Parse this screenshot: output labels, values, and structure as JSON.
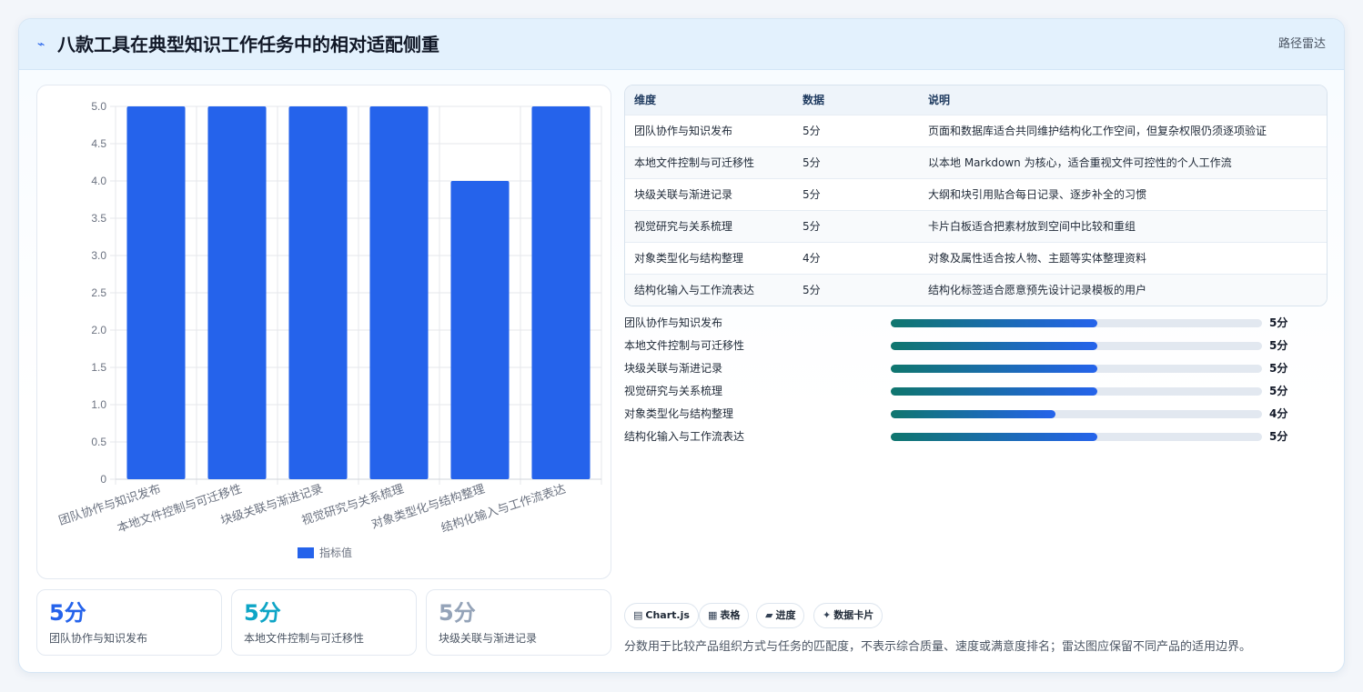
{
  "header": {
    "title": "八款工具在典型知识工作任务中的相对适配侧重",
    "tag": "路径雷达"
  },
  "chart_data": {
    "type": "bar",
    "categories": [
      "团队协作与知识发布",
      "本地文件控制与可迁移性",
      "块级关联与渐进记录",
      "视觉研究与关系梳理",
      "对象类型化与结构整理",
      "结构化输入与工作流表达"
    ],
    "series": [
      {
        "name": "指标值",
        "values": [
          5,
          5,
          5,
          5,
          4,
          5
        ],
        "color": "#2563eb"
      }
    ],
    "ylim": [
      0,
      5
    ],
    "yticks": [
      "0",
      "0.5",
      "1.0",
      "1.5",
      "2.0",
      "2.5",
      "3.0",
      "3.5",
      "4.0",
      "4.5",
      "5.0"
    ],
    "grid": true,
    "legend": "bottom"
  },
  "stats": [
    {
      "value": "5分",
      "label": "团队协作与知识发布",
      "color": "#2563eb"
    },
    {
      "value": "5分",
      "label": "本地文件控制与可迁移性",
      "color": "#0ea5c6"
    },
    {
      "value": "5分",
      "label": "块级关联与渐进记录",
      "color": "#94a3b8"
    }
  ],
  "table": {
    "headers": [
      "维度",
      "数据",
      "说明"
    ],
    "rows": [
      [
        "团队协作与知识发布",
        "5分",
        "页面和数据库适合共同维护结构化工作空间，但复杂权限仍须逐项验证"
      ],
      [
        "本地文件控制与可迁移性",
        "5分",
        "以本地 Markdown 为核心，适合重视文件可控性的个人工作流"
      ],
      [
        "块级关联与渐进记录",
        "5分",
        "大纲和块引用贴合每日记录、逐步补全的习惯"
      ],
      [
        "视觉研究与关系梳理",
        "5分",
        "卡片白板适合把素材放到空间中比较和重组"
      ],
      [
        "对象类型化与结构整理",
        "4分",
        "对象及属性适合按人物、主题等实体整理资料"
      ],
      [
        "结构化输入与工作流表达",
        "5分",
        "结构化标签适合愿意预先设计记录模板的用户"
      ]
    ]
  },
  "progress": [
    {
      "label": "团队协作与知识发布",
      "value": "5分",
      "fraction": 0.556
    },
    {
      "label": "本地文件控制与可迁移性",
      "value": "5分",
      "fraction": 0.556
    },
    {
      "label": "块级关联与渐进记录",
      "value": "5分",
      "fraction": 0.556
    },
    {
      "label": "视觉研究与关系梳理",
      "value": "5分",
      "fraction": 0.556
    },
    {
      "label": "对象类型化与结构整理",
      "value": "4分",
      "fraction": 0.444
    },
    {
      "label": "结构化输入与工作流表达",
      "value": "5分",
      "fraction": 0.556
    }
  ],
  "chips": [
    {
      "icon": "▤",
      "icon_name": "chart-icon",
      "label": "Chart.js"
    },
    {
      "icon": "▦",
      "icon_name": "table-icon",
      "label": "表格"
    },
    {
      "icon": "▰",
      "icon_name": "progress-icon",
      "label": "进度"
    },
    {
      "icon": "✦",
      "icon_name": "card-icon",
      "label": "数据卡片"
    }
  ],
  "footnote": "分数用于比较产品组织方式与任务的匹配度，不表示综合质量、速度或满意度排名；雷达图应保留不同产品的适用边界。"
}
